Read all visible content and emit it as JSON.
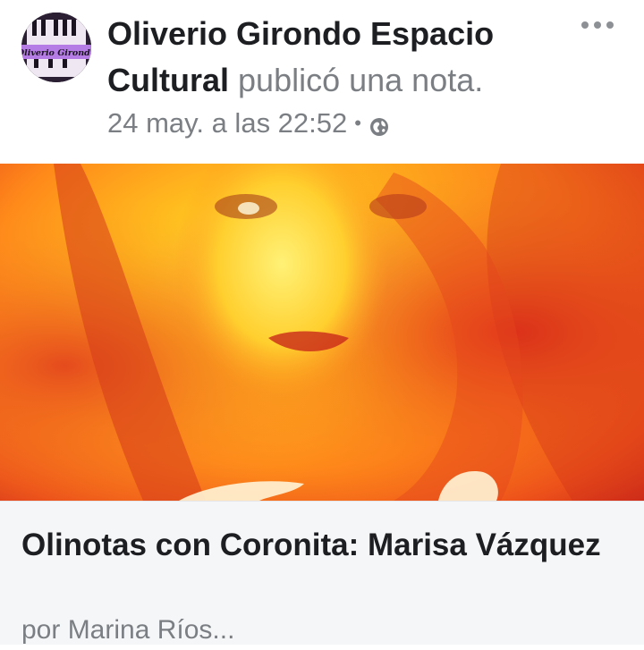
{
  "post": {
    "page_name": "Oliverio Girondo Espacio Cultural",
    "action": "publicó una nota.",
    "timestamp": "24 may. a las 22:52",
    "separator": "•",
    "privacy_icon": "globe-icon",
    "more_icon": "more-horizontal-icon",
    "avatar": {
      "logo_text": "Oliverio Girondo",
      "colors": {
        "bg": "#2a1f33",
        "band": "#b57ce6"
      }
    }
  },
  "cover": {
    "description_icon": "cover-photo",
    "colors": {
      "light": "#ffe44a",
      "mid": "#ff8a1a",
      "dark": "#c8201a"
    }
  },
  "note": {
    "title": "Olinotas con Coronita: Marisa Vázquez",
    "author": "por Marina Ríos..."
  },
  "colors": {
    "text_primary": "#1c1e21",
    "text_secondary": "#7b7f84",
    "card_bg": "#f5f6f7"
  }
}
